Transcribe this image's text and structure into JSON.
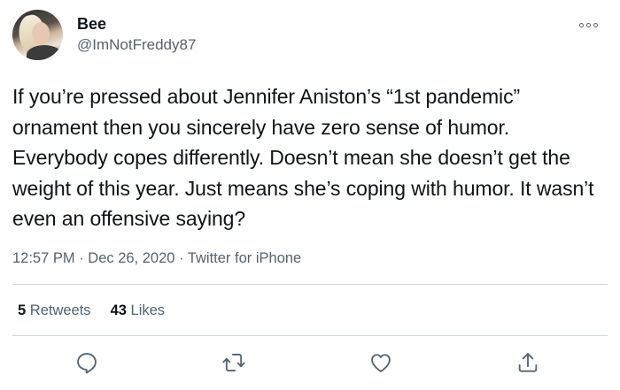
{
  "user": {
    "display_name": "Bee",
    "handle": "@ImNotFreddy87"
  },
  "tweet": {
    "text": "If you’re pressed about Jennifer Aniston’s “1st pandemic” ornament then you sincerely have zero sense of humor. Everybody copes differently. Doesn’t mean she doesn’t get the weight of this year. Just means she’s coping with humor. It wasn’t even an offensive saying?",
    "time": "12:57 PM",
    "date": "Dec 26, 2020",
    "source": "Twitter for iPhone",
    "separator": " · "
  },
  "stats": {
    "retweets_count": "5",
    "retweets_label": "Retweets",
    "likes_count": "43",
    "likes_label": "Likes"
  },
  "icons": {
    "more": "more-horizontal-icon",
    "reply": "reply-bubble-icon",
    "retweet": "retweet-icon",
    "like": "heart-icon",
    "share": "share-icon"
  },
  "colors": {
    "text_primary": "#0f1419",
    "text_secondary": "#536471",
    "divider": "#cfd9de"
  }
}
